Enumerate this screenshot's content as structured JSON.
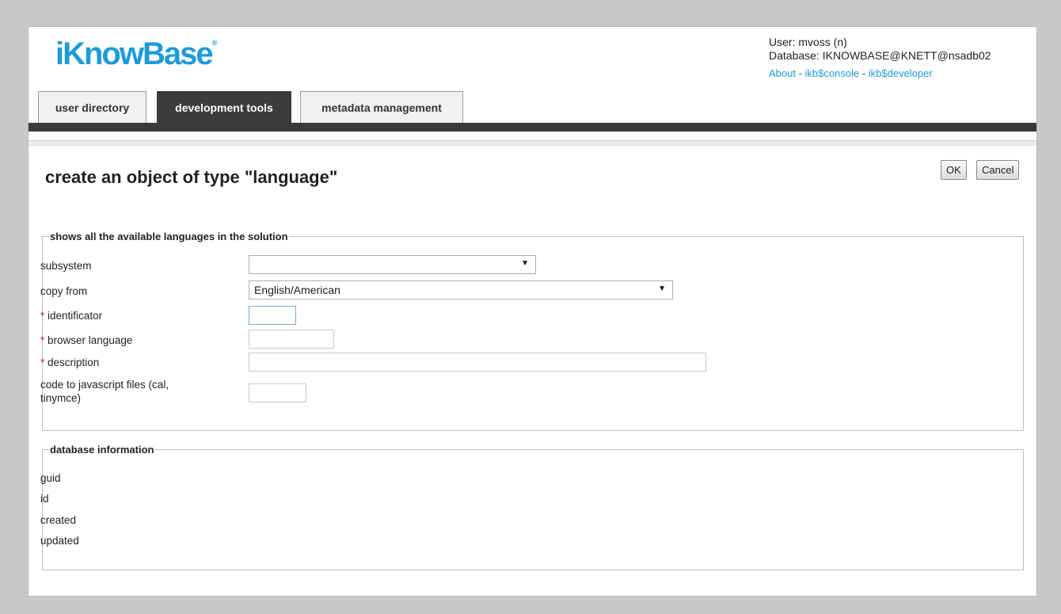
{
  "header": {
    "logo_text": "iKnowBase",
    "logo_mark": "®",
    "user_line": "User: mvoss (n)",
    "database_line": "Database: IKNOWBASE@KNETT@nsadb02",
    "links": {
      "about": "About",
      "sep1": " - ",
      "console": "ikb$console",
      "sep2": " - ",
      "developer": "ikb$developer"
    }
  },
  "tabs": [
    {
      "label": "user directory",
      "active": false
    },
    {
      "label": "development tools",
      "active": true
    },
    {
      "label": "metadata management",
      "active": false
    }
  ],
  "page": {
    "title": "create an object of type \"language\"",
    "ok_label": "OK",
    "cancel_label": "Cancel"
  },
  "form": {
    "legend": "shows all the available languages in the solution",
    "required_mark": "*",
    "subsystem": {
      "label": "subsystem",
      "value": ""
    },
    "copy_from": {
      "label": "copy from",
      "value": "English/American"
    },
    "identificator": {
      "label": "identificator",
      "value": ""
    },
    "browser_language": {
      "label": "browser language",
      "value": ""
    },
    "description": {
      "label": "description",
      "value": ""
    },
    "code_js": {
      "label_line1": "code to javascript files (cal,",
      "label_line2": "tinymce)",
      "value": ""
    }
  },
  "dbinfo": {
    "legend": "database information",
    "fields": [
      "guid",
      "id",
      "created",
      "updated"
    ]
  },
  "icons": {
    "dropdown": "▼"
  },
  "colors": {
    "brand": "#1e9bd7",
    "tab_active": "#3c3c3c",
    "required": "#d02020"
  }
}
